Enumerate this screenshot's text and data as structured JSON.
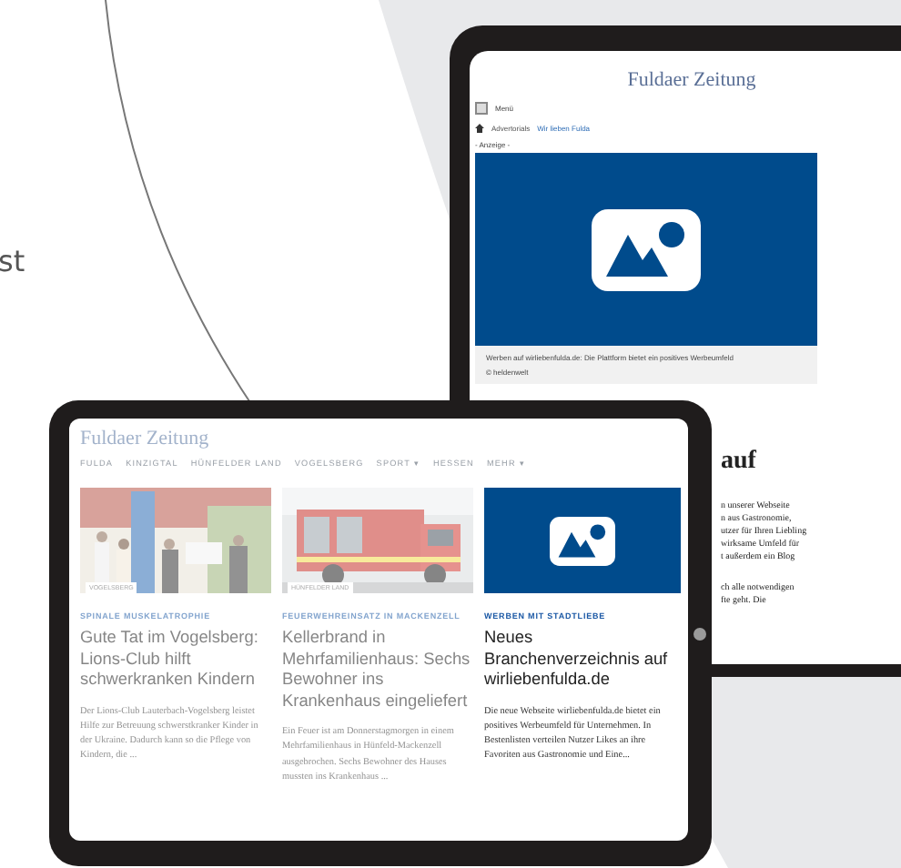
{
  "page_text": "st",
  "back_tablet": {
    "logo": "Fuldaer Zeitung",
    "menu_label": "Menü",
    "breadcrumb": [
      "Advertorials",
      "Wir lieben Fulda"
    ],
    "ad_label": "- Anzeige -",
    "caption": "Werben auf wirliebenfulda.de: Die Plattform bietet ein positives Werbeumfeld",
    "credit": "© heldenwelt",
    "article_heading": "auf",
    "article_lines": [
      "n unserer Webseite",
      "n aus Gastronomie,",
      "utzer für Ihren Liebling",
      "wirksame Umfeld für",
      "t außerdem ein Blog"
    ],
    "article_lines_2": [
      "ch alle notwendigen",
      "fte geht. Die"
    ]
  },
  "front_tablet": {
    "logo": "Fuldaer Zeitung",
    "nav": [
      {
        "label": "FULDA"
      },
      {
        "label": "KINZIGTAL"
      },
      {
        "label": "HÜNFELDER LAND"
      },
      {
        "label": "VOGELSBERG"
      },
      {
        "label": "SPORT",
        "caret": "▾"
      },
      {
        "label": "HESSEN"
      },
      {
        "label": "MEHR",
        "caret": "▾"
      }
    ],
    "articles": [
      {
        "faded": true,
        "tag": "VOGELSBERG",
        "kicker": "SPINALE MUSKELATROPHIE",
        "title": "Gute Tat im Vogelsberg: Lions-Club hilft schwerkranken Kindern",
        "teaser": "Der Lions-Club Lauterbach-Vogelsberg leistet Hilfe zur Betreuung schwerstkranker Kinder in der Ukraine. Dadurch kann so die Pflege von Kindern, die ..."
      },
      {
        "kind": "truck",
        "faded": true,
        "tag": "HÜNFELDER LAND",
        "kicker": "FEUERWEHREINSATZ IN MACKENZELL",
        "title": "Kellerbrand in Mehrfamilienhaus: Sechs Bewohner ins Krankenhaus eingeliefert",
        "teaser": "Ein Feuer ist am Donnerstagmorgen in einem Mehrfamilienhaus in Hünfeld-Mackenzell ausgebrochen. Sechs Bewohner des Hauses mussten ins Krankenhaus ..."
      },
      {
        "kind": "placeholder",
        "faded": false,
        "kicker": "WERBEN MIT STADTLIEBE",
        "title": "Neues Branchenverzeichnis auf wirliebenfulda.de",
        "teaser": "Die neue Webseite wirliebenfulda.de bietet ein positives Werbeumfeld für Unternehmen. In Bestenlisten verteilen Nutzer Likes an ihre Favoriten aus Gastronomie und Eine..."
      }
    ]
  }
}
